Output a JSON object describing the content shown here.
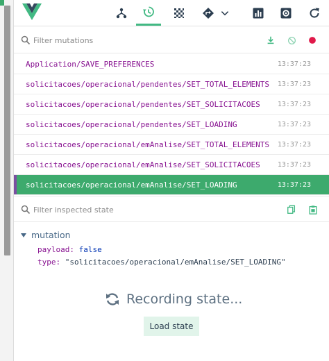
{
  "toolbar": {
    "logo": "vue-logo",
    "buttons": [
      "components-icon",
      "timeline-icon",
      "vuex-icon",
      "routing-icon",
      "chevron-down-icon",
      "performance-icon",
      "settings-icon",
      "refresh-icon"
    ],
    "active": "timeline-icon",
    "accent": "#42b983"
  },
  "mutations_filter": {
    "placeholder": "Filter mutations"
  },
  "mutations": [
    {
      "name": "Application/SAVE_PREFERENCES",
      "time": "13:37:23"
    },
    {
      "name": "solicitacoes/operacional/pendentes/SET_TOTAL_ELEMENTS",
      "time": "13:37:23"
    },
    {
      "name": "solicitacoes/operacional/pendentes/SET_SOLICITACOES",
      "time": "13:37:23"
    },
    {
      "name": "solicitacoes/operacional/pendentes/SET_LOADING",
      "time": "13:37:23"
    },
    {
      "name": "solicitacoes/operacional/emAnalise/SET_TOTAL_ELEMENTS",
      "time": "13:37:23"
    },
    {
      "name": "solicitacoes/operacional/emAnalise/SET_SOLICITACOES",
      "time": "13:37:23"
    },
    {
      "name": "solicitacoes/operacional/emAnalise/SET_LOADING",
      "time": "13:37:23",
      "selected": true
    }
  ],
  "state_filter": {
    "placeholder": "Filter inspected state"
  },
  "inspector": {
    "section_title": "mutation",
    "payload_key": "payload:",
    "payload_value": "false",
    "type_key": "type:",
    "type_value": "\"solicitacoes/operacional/emAnalise/SET_LOADING\""
  },
  "recording": {
    "text": "Recording state...",
    "load_label": "Load state"
  },
  "colors": {
    "selected_row": "#3daa6d",
    "selected_marker": "#7b4fa1",
    "record_dot": "#e0194a"
  }
}
